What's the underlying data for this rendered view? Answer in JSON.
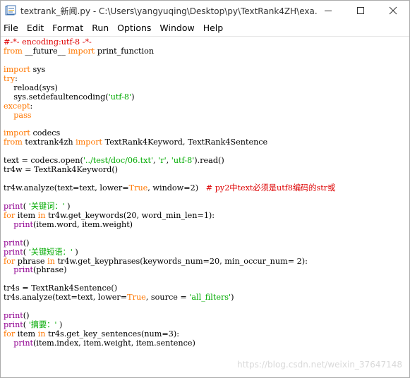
{
  "window": {
    "title": "textrank_新闻.py - C:\\Users\\yangyuqing\\Desktop\\py\\TextRank4ZH\\exa..."
  },
  "controls": {
    "minimize_icon": "minimize-icon",
    "maximize_icon": "maximize-icon",
    "close_icon": "close-icon"
  },
  "menu": [
    "File",
    "Edit",
    "Format",
    "Run",
    "Options",
    "Window",
    "Help"
  ],
  "colors": {
    "keyword": "#ff7700",
    "string": "#00aa00",
    "comment": "#dd0000",
    "builtin": "#900090",
    "text": "#000000"
  },
  "code_lines": [
    [
      [
        "com",
        "#-*- encoding:utf-8 -*-"
      ]
    ],
    [
      [
        "kw",
        "from"
      ],
      [
        "plain",
        " __future__ "
      ],
      [
        "kw",
        "import"
      ],
      [
        "plain",
        " print_function"
      ]
    ],
    [],
    [
      [
        "kw",
        "import"
      ],
      [
        "plain",
        " sys"
      ]
    ],
    [
      [
        "kw",
        "try"
      ],
      [
        "plain",
        ":"
      ]
    ],
    [
      [
        "plain",
        "    reload(sys)"
      ]
    ],
    [
      [
        "plain",
        "    sys.setdefaultencoding("
      ],
      [
        "str",
        "'utf-8'"
      ],
      [
        "plain",
        ")"
      ]
    ],
    [
      [
        "kw",
        "except"
      ],
      [
        "plain",
        ":"
      ]
    ],
    [
      [
        "plain",
        "    "
      ],
      [
        "kw",
        "pass"
      ]
    ],
    [],
    [
      [
        "kw",
        "import"
      ],
      [
        "plain",
        " codecs"
      ]
    ],
    [
      [
        "kw",
        "from"
      ],
      [
        "plain",
        " textrank4zh "
      ],
      [
        "kw",
        "import"
      ],
      [
        "plain",
        " TextRank4Keyword, TextRank4Sentence"
      ]
    ],
    [],
    [
      [
        "plain",
        "text = codecs.open("
      ],
      [
        "str",
        "'../test/doc/06.txt'"
      ],
      [
        "plain",
        ", "
      ],
      [
        "str",
        "'r'"
      ],
      [
        "plain",
        ", "
      ],
      [
        "str",
        "'utf-8'"
      ],
      [
        "plain",
        ").read()"
      ]
    ],
    [
      [
        "plain",
        "tr4w = TextRank4Keyword()"
      ]
    ],
    [],
    [
      [
        "plain",
        "tr4w.analyze(text=text, lower="
      ],
      [
        "kw",
        "True"
      ],
      [
        "plain",
        ", window=2)   "
      ],
      [
        "com",
        "# py2中text必须是utf8编码的str或"
      ]
    ],
    [],
    [
      [
        "builtin",
        "print"
      ],
      [
        "plain",
        "( "
      ],
      [
        "str",
        "'关键词：'"
      ],
      [
        "plain",
        " )"
      ]
    ],
    [
      [
        "kw",
        "for"
      ],
      [
        "plain",
        " item "
      ],
      [
        "kw",
        "in"
      ],
      [
        "plain",
        " tr4w.get_keywords(20, word_min_len=1):"
      ]
    ],
    [
      [
        "plain",
        "    "
      ],
      [
        "builtin",
        "print"
      ],
      [
        "plain",
        "(item.word, item.weight)"
      ]
    ],
    [],
    [
      [
        "builtin",
        "print"
      ],
      [
        "plain",
        "()"
      ]
    ],
    [
      [
        "builtin",
        "print"
      ],
      [
        "plain",
        "( "
      ],
      [
        "str",
        "'关键短语：'"
      ],
      [
        "plain",
        " )"
      ]
    ],
    [
      [
        "kw",
        "for"
      ],
      [
        "plain",
        " phrase "
      ],
      [
        "kw",
        "in"
      ],
      [
        "plain",
        " tr4w.get_keyphrases(keywords_num=20, min_occur_num= 2):"
      ]
    ],
    [
      [
        "plain",
        "    "
      ],
      [
        "builtin",
        "print"
      ],
      [
        "plain",
        "(phrase)"
      ]
    ],
    [],
    [
      [
        "plain",
        "tr4s = TextRank4Sentence()"
      ]
    ],
    [
      [
        "plain",
        "tr4s.analyze(text=text, lower="
      ],
      [
        "kw",
        "True"
      ],
      [
        "plain",
        ", source = "
      ],
      [
        "str",
        "'all_filters'"
      ],
      [
        "plain",
        ")"
      ]
    ],
    [],
    [
      [
        "builtin",
        "print"
      ],
      [
        "plain",
        "()"
      ]
    ],
    [
      [
        "builtin",
        "print"
      ],
      [
        "plain",
        "( "
      ],
      [
        "str",
        "'摘要：'"
      ],
      [
        "plain",
        " )"
      ]
    ],
    [
      [
        "kw",
        "for"
      ],
      [
        "plain",
        " item "
      ],
      [
        "kw",
        "in"
      ],
      [
        "plain",
        " tr4s.get_key_sentences(num=3):"
      ]
    ],
    [
      [
        "plain",
        "    "
      ],
      [
        "builtin",
        "print"
      ],
      [
        "plain",
        "(item.index, item.weight, item.sentence)"
      ]
    ]
  ],
  "watermark": "https://blog.csdn.net/weixin_37647148"
}
